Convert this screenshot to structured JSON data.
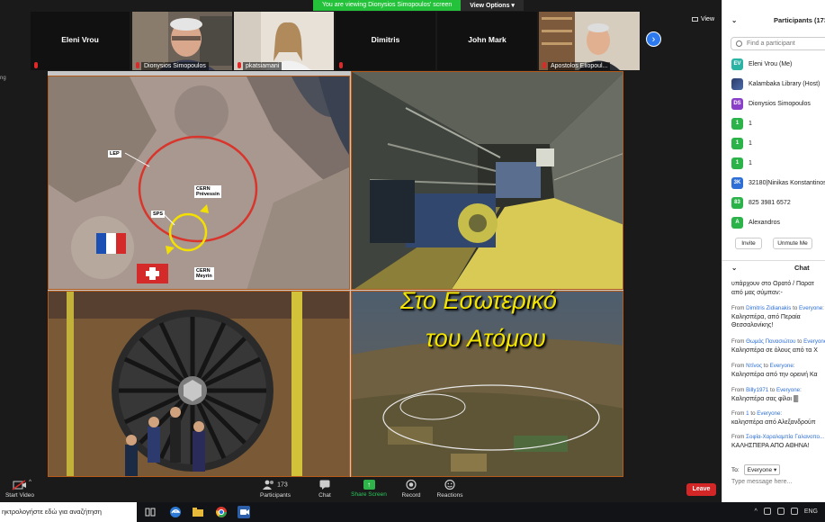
{
  "banner": {
    "viewing_text": "You are viewing Dionysios Simopoulos' screen",
    "view_options_label": "View Options ▾"
  },
  "view_button_label": "View",
  "left_edge_text": "ng",
  "thumbnails": [
    {
      "name": "Eleni Vrou",
      "type": "name"
    },
    {
      "label": "Dionysios Simopoulos",
      "type": "video"
    },
    {
      "label": "pkatsiamani",
      "type": "video"
    },
    {
      "name": "Dimitris",
      "type": "name"
    },
    {
      "name": "John Mark",
      "type": "name"
    },
    {
      "label": "Apostolos Eliopoul...",
      "type": "video"
    }
  ],
  "slide": {
    "title_line1": "Στο Εσωτερικό",
    "title_line2": "του Ατόμου",
    "map_labels": {
      "lep": "LEP",
      "sps": "SPS",
      "cern_prevessin": "CERN\nPrévessin",
      "cern_meyrin": "CERN\nMeyrin"
    }
  },
  "toolbar": {
    "start_video": "Start Video",
    "participants": "Participants",
    "participants_count": "173",
    "chat": "Chat",
    "share_screen": "Share Screen",
    "record": "Record",
    "reactions": "Reactions",
    "leave": "Leave"
  },
  "participants_panel": {
    "title": "Participants (173)",
    "search_placeholder": "Find a participant",
    "list": [
      {
        "initials": "EV",
        "name": "Eleni Vrou (Me)",
        "color": "#2bb3a4"
      },
      {
        "initials": "",
        "name": "Kalambaka Library (Host)",
        "color": "#2a3c6b",
        "image": true
      },
      {
        "initials": "DS",
        "name": "Dionysios Simopoulos",
        "color": "#8a3fc9"
      },
      {
        "initials": "1",
        "name": "1",
        "color": "#2bb34a"
      },
      {
        "initials": "1",
        "name": "1",
        "color": "#2bb34a"
      },
      {
        "initials": "1",
        "name": "1",
        "color": "#2bb34a"
      },
      {
        "initials": "3K",
        "name": "32180|Ninikas Konstantinos",
        "color": "#2d6fd6"
      },
      {
        "initials": "83",
        "name": "825 3981 6572",
        "color": "#2bb34a"
      },
      {
        "initials": "A",
        "name": "Alexandros",
        "color": "#2bb34a"
      }
    ],
    "invite_label": "Invite",
    "unmute_me_label": "Unmute Me"
  },
  "chat_panel": {
    "title": "Chat",
    "first_lines": [
      "υπάρχουν στο Ορατό / Παρατ",
      "από μας σύμπαν:-"
    ],
    "messages": [
      {
        "from": "Dimitris Zidianakis",
        "to": "Everyone",
        "lines": [
          "Καλησπέρα, από Περαία",
          "Θεσσαλονίκης!"
        ]
      },
      {
        "from": "Θωμάς Πανασιώτου",
        "to": "Everyone",
        "lines": [
          "Καλησπέρα σε όλους από τα Χ"
        ]
      },
      {
        "from": "Ντίνος",
        "to": "Everyone",
        "lines": [
          "Καλησπέρα από την ορεινή Κα"
        ]
      },
      {
        "from": "Billy1971",
        "to": "Everyone",
        "lines": [
          "Καλησπέρα σας φίλοι 🀫"
        ]
      },
      {
        "from": "1",
        "to": "Everyone",
        "lines": [
          "καλησπέρα από Αλεξανδρούπ"
        ]
      },
      {
        "from": "Σοφία-Χαραλαμπία Γαλανοπο...",
        "to": "",
        "lines": [
          "ΚΑΛΗΣΠΕΡΑ ΑΠΟ ΑΘΗΝΑ!"
        ]
      }
    ],
    "from_word": "From",
    "to_word": "to",
    "to_label": "To:",
    "to_value": "Everyone ▾",
    "input_placeholder": "Type message here..."
  },
  "taskbar": {
    "search_text": "ηκτρολογήστε εδώ για αναζήτηση",
    "lang": "ENG"
  }
}
